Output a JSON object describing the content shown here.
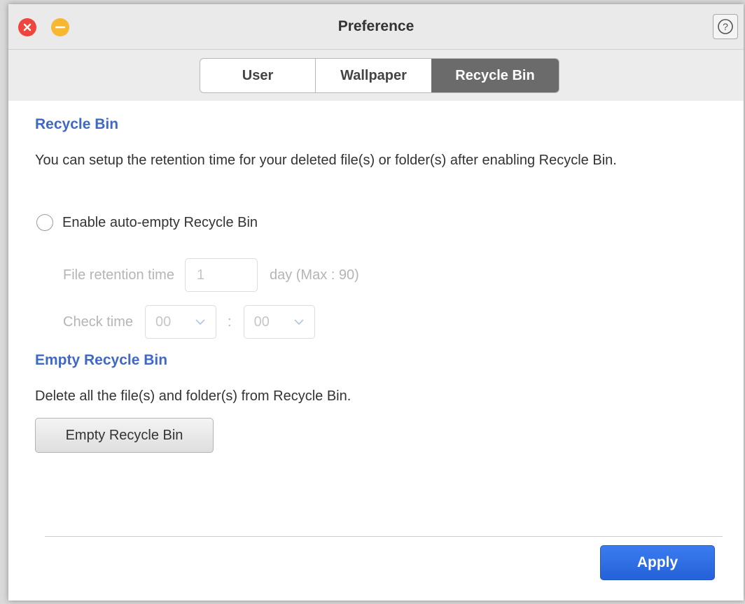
{
  "window": {
    "title": "Preference",
    "help_label": "?"
  },
  "tabs": [
    {
      "label": "User",
      "active": false
    },
    {
      "label": "Wallpaper",
      "active": false
    },
    {
      "label": "Recycle Bin",
      "active": true
    }
  ],
  "recycle_bin": {
    "section_title": "Recycle Bin",
    "description": "You can setup the retention time for your deleted file(s) or folder(s) after enabling Recycle Bin.",
    "auto_empty": {
      "label": "Enable auto-empty Recycle Bin",
      "checked": false
    },
    "retention": {
      "label": "File retention time",
      "value": "1",
      "unit": "day (Max : 90)"
    },
    "check_time": {
      "label": "Check time",
      "hour": "00",
      "separator": ":",
      "minute": "00"
    }
  },
  "empty_section": {
    "title": "Empty Recycle Bin",
    "description": "Delete all the file(s) and folder(s) from Recycle Bin.",
    "button_label": "Empty Recycle Bin"
  },
  "footer": {
    "apply_label": "Apply"
  },
  "colors": {
    "accent": "#3f68c7",
    "close": "#f0453c",
    "minimize": "#f7b731",
    "apply": "#2b6be0",
    "active_tab": "#6b6b6b"
  },
  "icons": [
    "close-icon",
    "minimize-icon",
    "help-icon",
    "chevron-down-icon"
  ]
}
